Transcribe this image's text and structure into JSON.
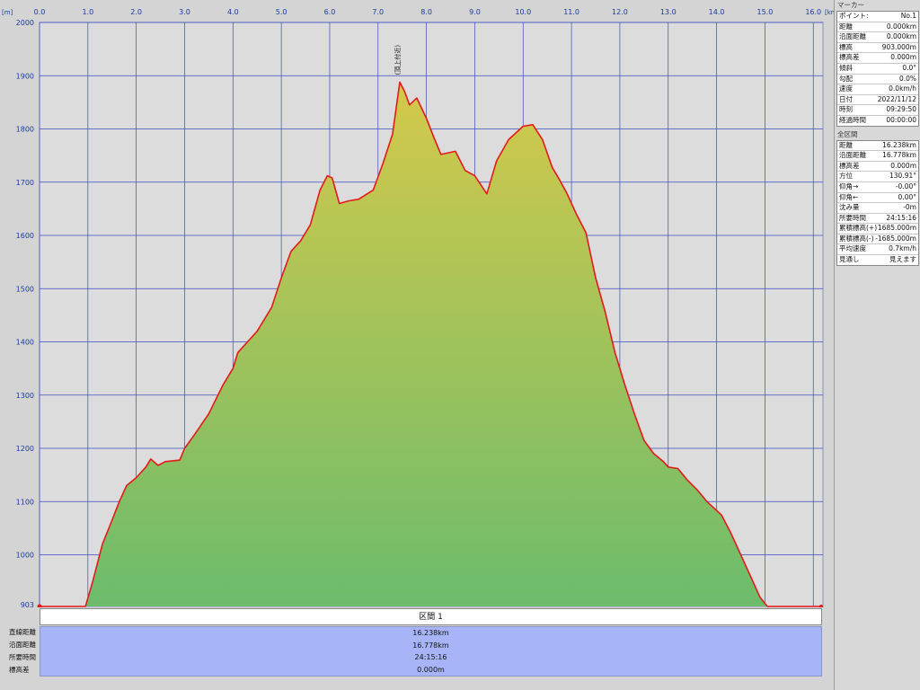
{
  "chart_data": {
    "type": "area",
    "xlabel": "",
    "ylabel": "",
    "x_unit": "[km]",
    "y_unit": "[m]",
    "xlim": [
      0,
      16.2
    ],
    "ylim": [
      903,
      2000
    ],
    "x_ticks": [
      "0.0",
      "1.0",
      "2.0",
      "3.0",
      "4.0",
      "5.0",
      "6.0",
      "7.0",
      "8.0",
      "9.0",
      "10.0",
      "11.0",
      "12.0",
      "13.0",
      "14.0",
      "15.0",
      "16.0"
    ],
    "y_ticks": [
      "1000",
      "1100",
      "1200",
      "1300",
      "1400",
      "1500",
      "1600",
      "1700",
      "1800",
      "1900",
      "2000"
    ],
    "y_base_label": "903",
    "grid": true,
    "annotation": {
      "text": "(頂上付近)",
      "x": 7.45,
      "y": 1888
    },
    "series": [
      {
        "points": [
          [
            0,
            903
          ],
          [
            0.95,
            903
          ],
          [
            1.1,
            950
          ],
          [
            1.3,
            1020
          ],
          [
            1.5,
            1065
          ],
          [
            1.65,
            1100
          ],
          [
            1.8,
            1130
          ],
          [
            2.0,
            1145
          ],
          [
            2.2,
            1165
          ],
          [
            2.3,
            1180
          ],
          [
            2.45,
            1168
          ],
          [
            2.6,
            1175
          ],
          [
            2.9,
            1178
          ],
          [
            3.0,
            1200
          ],
          [
            3.2,
            1225
          ],
          [
            3.5,
            1265
          ],
          [
            3.8,
            1320
          ],
          [
            4.0,
            1350
          ],
          [
            4.1,
            1380
          ],
          [
            4.3,
            1400
          ],
          [
            4.5,
            1420
          ],
          [
            4.8,
            1465
          ],
          [
            5.0,
            1520
          ],
          [
            5.2,
            1570
          ],
          [
            5.4,
            1590
          ],
          [
            5.6,
            1620
          ],
          [
            5.8,
            1685
          ],
          [
            5.95,
            1712
          ],
          [
            6.05,
            1708
          ],
          [
            6.2,
            1660
          ],
          [
            6.4,
            1665
          ],
          [
            6.6,
            1668
          ],
          [
            6.9,
            1685
          ],
          [
            7.1,
            1735
          ],
          [
            7.3,
            1790
          ],
          [
            7.45,
            1888
          ],
          [
            7.55,
            1870
          ],
          [
            7.65,
            1845
          ],
          [
            7.8,
            1858
          ],
          [
            8.0,
            1820
          ],
          [
            8.15,
            1785
          ],
          [
            8.3,
            1752
          ],
          [
            8.6,
            1758
          ],
          [
            8.8,
            1722
          ],
          [
            9.0,
            1712
          ],
          [
            9.25,
            1678
          ],
          [
            9.45,
            1740
          ],
          [
            9.7,
            1780
          ],
          [
            10.0,
            1805
          ],
          [
            10.2,
            1808
          ],
          [
            10.4,
            1780
          ],
          [
            10.6,
            1728
          ],
          [
            10.75,
            1705
          ],
          [
            10.9,
            1680
          ],
          [
            11.1,
            1640
          ],
          [
            11.3,
            1605
          ],
          [
            11.5,
            1520
          ],
          [
            11.7,
            1455
          ],
          [
            11.9,
            1380
          ],
          [
            12.1,
            1320
          ],
          [
            12.3,
            1265
          ],
          [
            12.5,
            1215
          ],
          [
            12.7,
            1190
          ],
          [
            12.9,
            1175
          ],
          [
            13.0,
            1165
          ],
          [
            13.2,
            1162
          ],
          [
            13.4,
            1140
          ],
          [
            13.6,
            1122
          ],
          [
            13.8,
            1100
          ],
          [
            14.1,
            1075
          ],
          [
            14.3,
            1040
          ],
          [
            14.5,
            1000
          ],
          [
            14.7,
            960
          ],
          [
            14.9,
            920
          ],
          [
            15.05,
            903
          ],
          [
            16.2,
            903
          ]
        ]
      }
    ]
  },
  "marker_panel": {
    "title": "マーカー",
    "rows": [
      {
        "label": "ポイント:",
        "value": "No.1"
      },
      {
        "label": "距離",
        "value": "0.000km"
      },
      {
        "label": "沿面距離",
        "value": "0.000km"
      },
      {
        "label": "標高",
        "value": "903.000m"
      },
      {
        "label": "標高差",
        "value": "0.000m"
      },
      {
        "label": "傾斜",
        "value": "0.0°"
      },
      {
        "label": "勾配",
        "value": "0.0%"
      },
      {
        "label": "速度",
        "value": "0.0km/h"
      },
      {
        "label": "日付",
        "value": "2022/11/12"
      },
      {
        "label": "時刻",
        "value": "09:29:50"
      },
      {
        "label": "経過時間",
        "value": "00:00:00"
      }
    ]
  },
  "section_panel": {
    "title": "全区間",
    "rows": [
      {
        "label": "距離",
        "value": "16.238km"
      },
      {
        "label": "沿面距離",
        "value": "16.778km"
      },
      {
        "label": "標高差",
        "value": "0.000m"
      },
      {
        "label": "方位",
        "value": "130.91°"
      },
      {
        "label": "仰角→",
        "value": "-0.00°"
      },
      {
        "label": "仰角←",
        "value": "0.00°"
      },
      {
        "label": "沈み量",
        "value": "-0m"
      },
      {
        "label": "所要時間",
        "value": "24:15:16"
      },
      {
        "label": "累積標高(+)",
        "value": "1685.000m"
      },
      {
        "label": "累積標高(-)",
        "value": "-1685.000m"
      },
      {
        "label": "平均速度",
        "value": "0.7km/h"
      },
      {
        "label": "見通し",
        "value": "見えます"
      }
    ]
  },
  "section_bar": {
    "label": "区間 1"
  },
  "summary": {
    "labels": [
      "直線距離",
      "沿面距離",
      "所要時間",
      "標高差"
    ],
    "values": [
      "16.238km",
      "16.778km",
      "24:15:16",
      "0.000m"
    ]
  },
  "colors": {
    "plot_bg": "#dcdcdc",
    "grid": "#3c4bbf",
    "line": "#e41a1a",
    "fill_top": "#d4c94a",
    "fill_bottom": "#6cbc6c",
    "summary_bg": "#a7b5f8"
  }
}
